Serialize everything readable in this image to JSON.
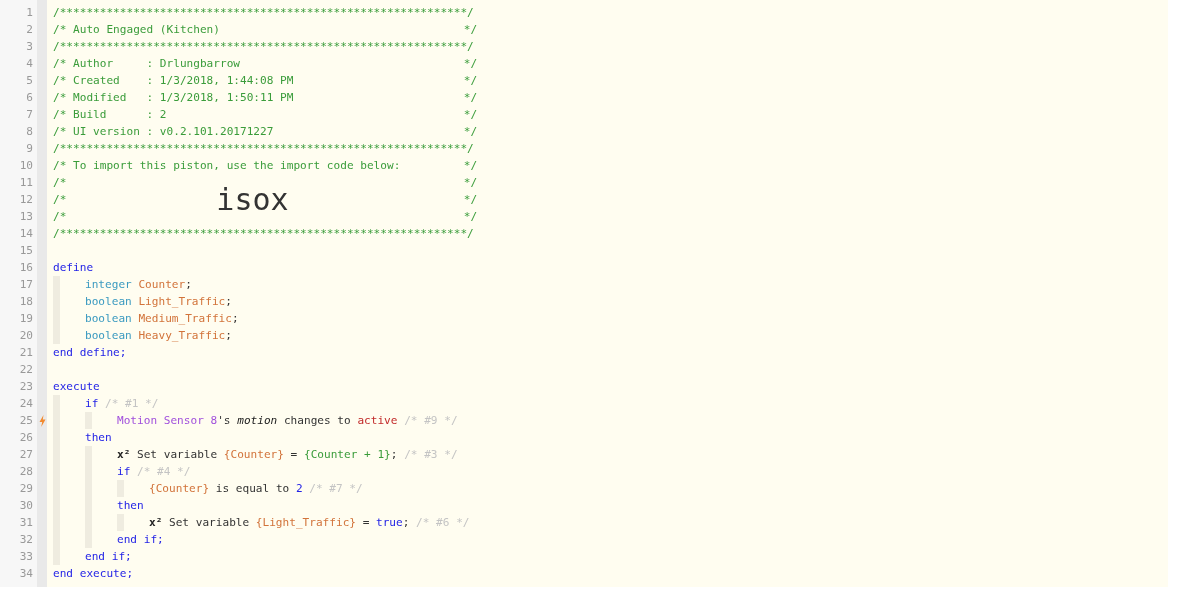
{
  "editor": {
    "lines": [
      {
        "number": "1",
        "trigger": false,
        "tokens": [
          {
            "kind": "comment",
            "text": "/*************************************************************/"
          }
        ]
      },
      {
        "number": "2",
        "trigger": false,
        "tokens": [
          {
            "kind": "comment",
            "text": "/* Auto Engaged (Kitchen)"
          }
        ],
        "close": "*/"
      },
      {
        "number": "3",
        "trigger": false,
        "tokens": [
          {
            "kind": "comment",
            "text": "/*************************************************************/"
          }
        ]
      },
      {
        "number": "4",
        "trigger": false,
        "tokens": [
          {
            "kind": "comment",
            "text": "/* Author     : Drlungbarrow"
          }
        ],
        "close": "*/"
      },
      {
        "number": "5",
        "trigger": false,
        "tokens": [
          {
            "kind": "comment",
            "text": "/* Created    : 1/3/2018, 1:44:08 PM"
          }
        ],
        "close": "*/"
      },
      {
        "number": "6",
        "trigger": false,
        "tokens": [
          {
            "kind": "comment",
            "text": "/* Modified   : 1/3/2018, 1:50:11 PM"
          }
        ],
        "close": "*/"
      },
      {
        "number": "7",
        "trigger": false,
        "tokens": [
          {
            "kind": "comment",
            "text": "/* Build      : 2"
          }
        ],
        "close": "*/"
      },
      {
        "number": "8",
        "trigger": false,
        "tokens": [
          {
            "kind": "comment",
            "text": "/* UI version : v0.2.101.20171227"
          }
        ],
        "close": "*/"
      },
      {
        "number": "9",
        "trigger": false,
        "tokens": [
          {
            "kind": "comment",
            "text": "/*************************************************************/"
          }
        ]
      },
      {
        "number": "10",
        "trigger": false,
        "tokens": [
          {
            "kind": "comment",
            "text": "/* To import this piston, use the import code below:"
          }
        ],
        "close": "*/"
      },
      {
        "number": "11",
        "trigger": false,
        "tokens": [
          {
            "kind": "comment",
            "text": "/*"
          }
        ],
        "close": "*/"
      },
      {
        "number": "12",
        "trigger": false,
        "tokens": [
          {
            "kind": "comment",
            "text": "/*"
          },
          {
            "kind": "import-code",
            "text": "isox"
          }
        ],
        "close": "*/"
      },
      {
        "number": "13",
        "trigger": false,
        "tokens": [
          {
            "kind": "comment",
            "text": "/*"
          }
        ],
        "close": "*/"
      },
      {
        "number": "14",
        "trigger": false,
        "tokens": [
          {
            "kind": "comment",
            "text": "/*************************************************************/"
          }
        ]
      },
      {
        "number": "15",
        "trigger": false
      },
      {
        "number": "16",
        "trigger": false,
        "tokens": [
          {
            "kind": "keyword",
            "text": "define"
          }
        ],
        "children": [
          {
            "number": "17",
            "trigger": false,
            "tokens": [
              {
                "kind": "type",
                "text": "integer"
              },
              {
                "kind": "variable",
                "text": "Counter"
              },
              {
                "kind": "plain",
                "text": ";",
                "tight": true
              }
            ]
          },
          {
            "number": "18",
            "trigger": false,
            "tokens": [
              {
                "kind": "type",
                "text": "boolean"
              },
              {
                "kind": "variable",
                "text": "Light_Traffic"
              },
              {
                "kind": "plain",
                "text": ";",
                "tight": true
              }
            ]
          },
          {
            "number": "19",
            "trigger": false,
            "tokens": [
              {
                "kind": "type",
                "text": "boolean"
              },
              {
                "kind": "variable",
                "text": "Medium_Traffic"
              },
              {
                "kind": "plain",
                "text": ";",
                "tight": true
              }
            ]
          },
          {
            "number": "20",
            "trigger": false,
            "tokens": [
              {
                "kind": "type",
                "text": "boolean"
              },
              {
                "kind": "variable",
                "text": "Heavy_Traffic"
              },
              {
                "kind": "plain",
                "text": ";",
                "tight": true
              }
            ]
          }
        ]
      },
      {
        "number": "21",
        "trigger": false,
        "tokens": [
          {
            "kind": "keyword",
            "text": "end define;"
          }
        ]
      },
      {
        "number": "22",
        "trigger": false
      },
      {
        "number": "23",
        "trigger": false,
        "tokens": [
          {
            "kind": "keyword",
            "text": "execute"
          }
        ],
        "children": [
          {
            "number": "24",
            "trigger": false,
            "tokens": [
              {
                "kind": "keyword",
                "text": "if"
              },
              {
                "kind": "note",
                "text": "/* #1 */"
              }
            ],
            "children": [
              {
                "number": "25",
                "trigger": true,
                "tokens": [
                  {
                    "kind": "device",
                    "text": "Motion Sensor 8"
                  },
                  {
                    "kind": "plain",
                    "text": "'s",
                    "tight": true
                  },
                  {
                    "kind": "attribute",
                    "text": "motion"
                  },
                  {
                    "kind": "plain",
                    "text": "changes to"
                  },
                  {
                    "kind": "value",
                    "text": "active"
                  },
                  {
                    "kind": "note",
                    "text": "/* #9 */"
                  }
                ]
              }
            ]
          },
          {
            "number": "26",
            "trigger": false,
            "tokens": [
              {
                "kind": "keyword",
                "text": "then"
              }
            ],
            "children": [
              {
                "number": "27",
                "trigger": false,
                "tokens": [
                  {
                    "kind": "op",
                    "text": "x²"
                  },
                  {
                    "kind": "plain",
                    "text": "Set variable"
                  },
                  {
                    "kind": "variable",
                    "text": "{Counter}"
                  },
                  {
                    "kind": "plain",
                    "text": "="
                  },
                  {
                    "kind": "expression",
                    "text": "{Counter + 1}"
                  },
                  {
                    "kind": "plain",
                    "text": ";",
                    "tight": true
                  },
                  {
                    "kind": "note",
                    "text": "/* #3 */"
                  }
                ]
              },
              {
                "number": "28",
                "trigger": false,
                "tokens": [
                  {
                    "kind": "keyword",
                    "text": "if"
                  },
                  {
                    "kind": "note",
                    "text": "/* #4 */"
                  }
                ],
                "children": [
                  {
                    "number": "29",
                    "trigger": false,
                    "tokens": [
                      {
                        "kind": "variable",
                        "text": "{Counter}"
                      },
                      {
                        "kind": "plain",
                        "text": "is equal to"
                      },
                      {
                        "kind": "literal",
                        "text": "2"
                      },
                      {
                        "kind": "note",
                        "text": "/* #7 */"
                      }
                    ]
                  }
                ]
              },
              {
                "number": "30",
                "trigger": false,
                "tokens": [
                  {
                    "kind": "keyword",
                    "text": "then"
                  }
                ],
                "children": [
                  {
                    "number": "31",
                    "trigger": false,
                    "tokens": [
                      {
                        "kind": "op",
                        "text": "x²"
                      },
                      {
                        "kind": "plain",
                        "text": "Set variable"
                      },
                      {
                        "kind": "variable",
                        "text": "{Light_Traffic}"
                      },
                      {
                        "kind": "plain",
                        "text": "="
                      },
                      {
                        "kind": "literal",
                        "text": "true"
                      },
                      {
                        "kind": "plain",
                        "text": ";",
                        "tight": true
                      },
                      {
                        "kind": "note",
                        "text": "/* #6 */"
                      }
                    ]
                  }
                ]
              },
              {
                "number": "32",
                "trigger": false,
                "tokens": [
                  {
                    "kind": "keyword",
                    "text": "end if;"
                  }
                ]
              }
            ]
          },
          {
            "number": "33",
            "trigger": false,
            "tokens": [
              {
                "kind": "keyword",
                "text": "end if;"
              }
            ]
          }
        ]
      },
      {
        "number": "34",
        "trigger": false,
        "tokens": [
          {
            "kind": "keyword",
            "text": "end execute;"
          }
        ]
      }
    ]
  }
}
